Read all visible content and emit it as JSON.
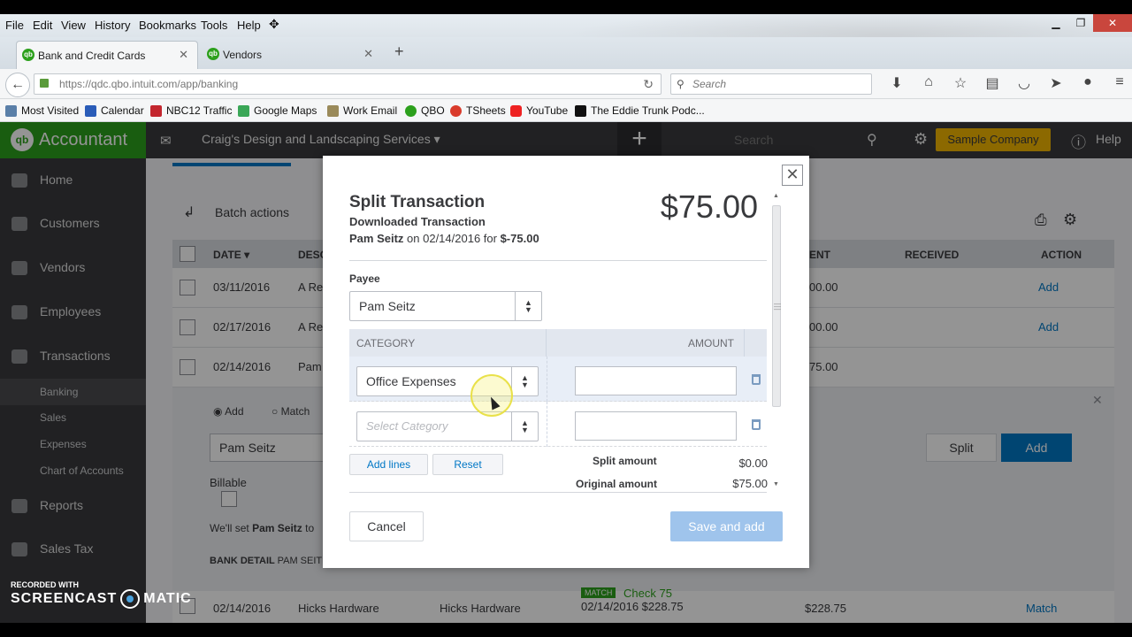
{
  "browser": {
    "menu": [
      "File",
      "Edit",
      "View",
      "History",
      "Bookmarks",
      "Tools",
      "Help"
    ],
    "tabs": [
      {
        "label": "Bank and Credit Cards",
        "active": true
      },
      {
        "label": "Vendors",
        "active": false
      }
    ],
    "url": "https://qdc.qbo.intuit.com/app/banking",
    "search_placeholder": "Search",
    "bookmarks": [
      "Most Visited",
      "Calendar",
      "NBC12 Traffic",
      "Google Maps",
      "Work Email",
      "QBO",
      "TSheets",
      "YouTube",
      "The Eddie Trunk Podc..."
    ]
  },
  "app": {
    "brand": "Accountant",
    "company": "Craig's Design and Landscaping Services ▾",
    "search_placeholder": "Search",
    "sample_button": "Sample Company",
    "help": "Help",
    "sidebar": {
      "items": [
        "Home",
        "Customers",
        "Vendors",
        "Employees",
        "Transactions"
      ],
      "subitems": [
        "Banking",
        "Sales",
        "Expenses",
        "Chart of Accounts"
      ],
      "items2": [
        "Reports",
        "Sales Tax"
      ]
    },
    "batch_actions": "Batch actions",
    "columns": {
      "date": "DATE ▾",
      "desc": "DESC",
      "payment": "ENT",
      "received": "RECEIVED",
      "action": "ACTION"
    },
    "rows": [
      {
        "date": "03/11/2016",
        "desc": "A Re",
        "payment": "00.00",
        "action": "Add"
      },
      {
        "date": "02/17/2016",
        "desc": "A Re",
        "payment": "00.00",
        "action": "Add"
      },
      {
        "date": "02/14/2016",
        "desc": "Pam",
        "payment": "75.00",
        "action": ""
      }
    ],
    "expanded": {
      "radio_add": "Add",
      "radio_match": "Match",
      "payee": "Pam Seitz",
      "billable": "Billable",
      "select_cat": "Select C",
      "note_prefix": "We'll set",
      "note_name": "Pam Seitz",
      "note_suffix": "to",
      "bank_detail": "BANK DETAIL",
      "bank_detail_value": "PAM SEIT",
      "split": "Split",
      "add": "Add"
    },
    "bottom_row": {
      "date": "02/14/2016",
      "desc": "Hicks Hardware",
      "payee": "Hicks Hardware",
      "match_badge": "MATCH",
      "match_check": "Check 75",
      "match_detail": "02/14/2016 $228.75",
      "payment": "$228.75",
      "action": "Match"
    }
  },
  "dialog": {
    "title": "Split Transaction",
    "subtitle": "Downloaded Transaction",
    "info_name": "Pam Seitz",
    "info_on": " on 02/14/2016 for ",
    "info_amount": "$-75.00",
    "amount": "$75.00",
    "payee_label": "Payee",
    "payee_value": "Pam Seitz",
    "col_category": "CATEGORY",
    "col_amount": "AMOUNT",
    "lines": [
      {
        "category": "Office Expenses",
        "amount": ""
      },
      {
        "category": "Select Category",
        "amount": ""
      }
    ],
    "add_lines": "Add lines",
    "reset": "Reset",
    "split_amount_label": "Split amount",
    "split_amount": "$0.00",
    "original_amount_label": "Original amount",
    "original_amount": "$75.00",
    "cancel": "Cancel",
    "save_and_add": "Save and add"
  },
  "watermark": {
    "recorded": "RECORDED WITH",
    "left": "SCREENCAST",
    "right": "MATIC"
  }
}
